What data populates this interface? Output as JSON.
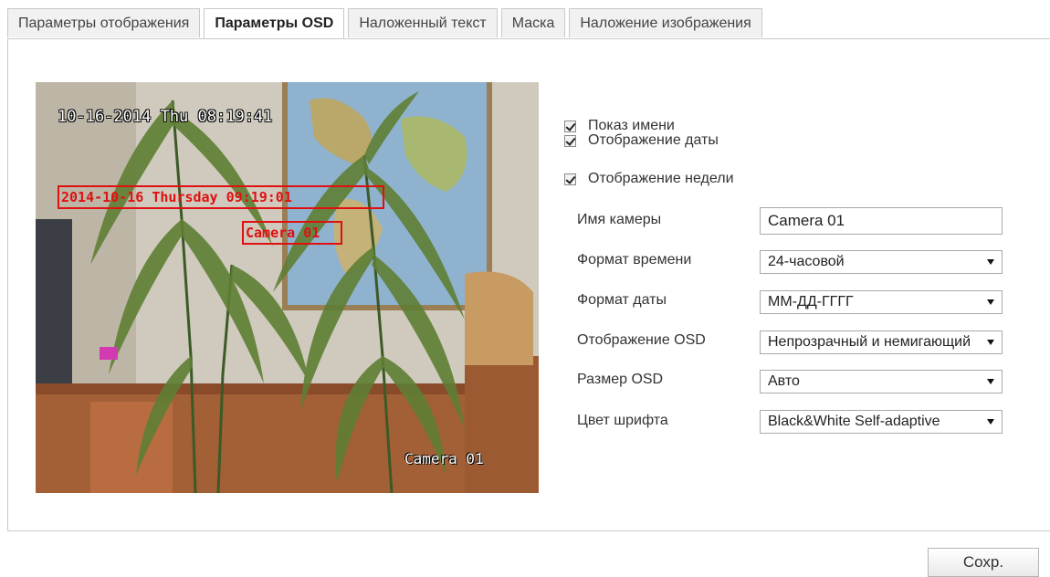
{
  "tabs": [
    {
      "label": "Параметры отображения",
      "active": false
    },
    {
      "label": "Параметры OSD",
      "active": true
    },
    {
      "label": "Наложенный текст",
      "active": false
    },
    {
      "label": "Маска",
      "active": false
    },
    {
      "label": "Наложение изображения",
      "active": false
    }
  ],
  "preview": {
    "osd_datetime": "10-16-2014 Thu 08:19:41",
    "osd_camera_name": "Camera 01",
    "red_box_datetime": "2014-10-16 Thursday 09:19:01",
    "red_box_camera": "Camera 01"
  },
  "checkboxes": [
    {
      "label": "Показ имени",
      "checked": true
    },
    {
      "label": "Отображение даты",
      "checked": true
    },
    {
      "label": "Отображение недели",
      "checked": true
    }
  ],
  "fields": {
    "camera_name": {
      "label": "Имя камеры",
      "value": "Camera 01"
    },
    "time_format": {
      "label": "Формат времени",
      "value": "24-часовой"
    },
    "date_format": {
      "label": "Формат даты",
      "value": "ММ-ДД-ГГГГ"
    },
    "osd_display": {
      "label": "Отображение OSD",
      "value": "Непрозрачный и немигающий"
    },
    "osd_size": {
      "label": "Размер OSD",
      "value": "Авто"
    },
    "font_color": {
      "label": "Цвет шрифта",
      "value": "Black&White Self-adaptive"
    }
  },
  "save_label": "Сохр.",
  "colors": {
    "osd_box": "#e01010",
    "tab_border": "#c9c9c9"
  }
}
